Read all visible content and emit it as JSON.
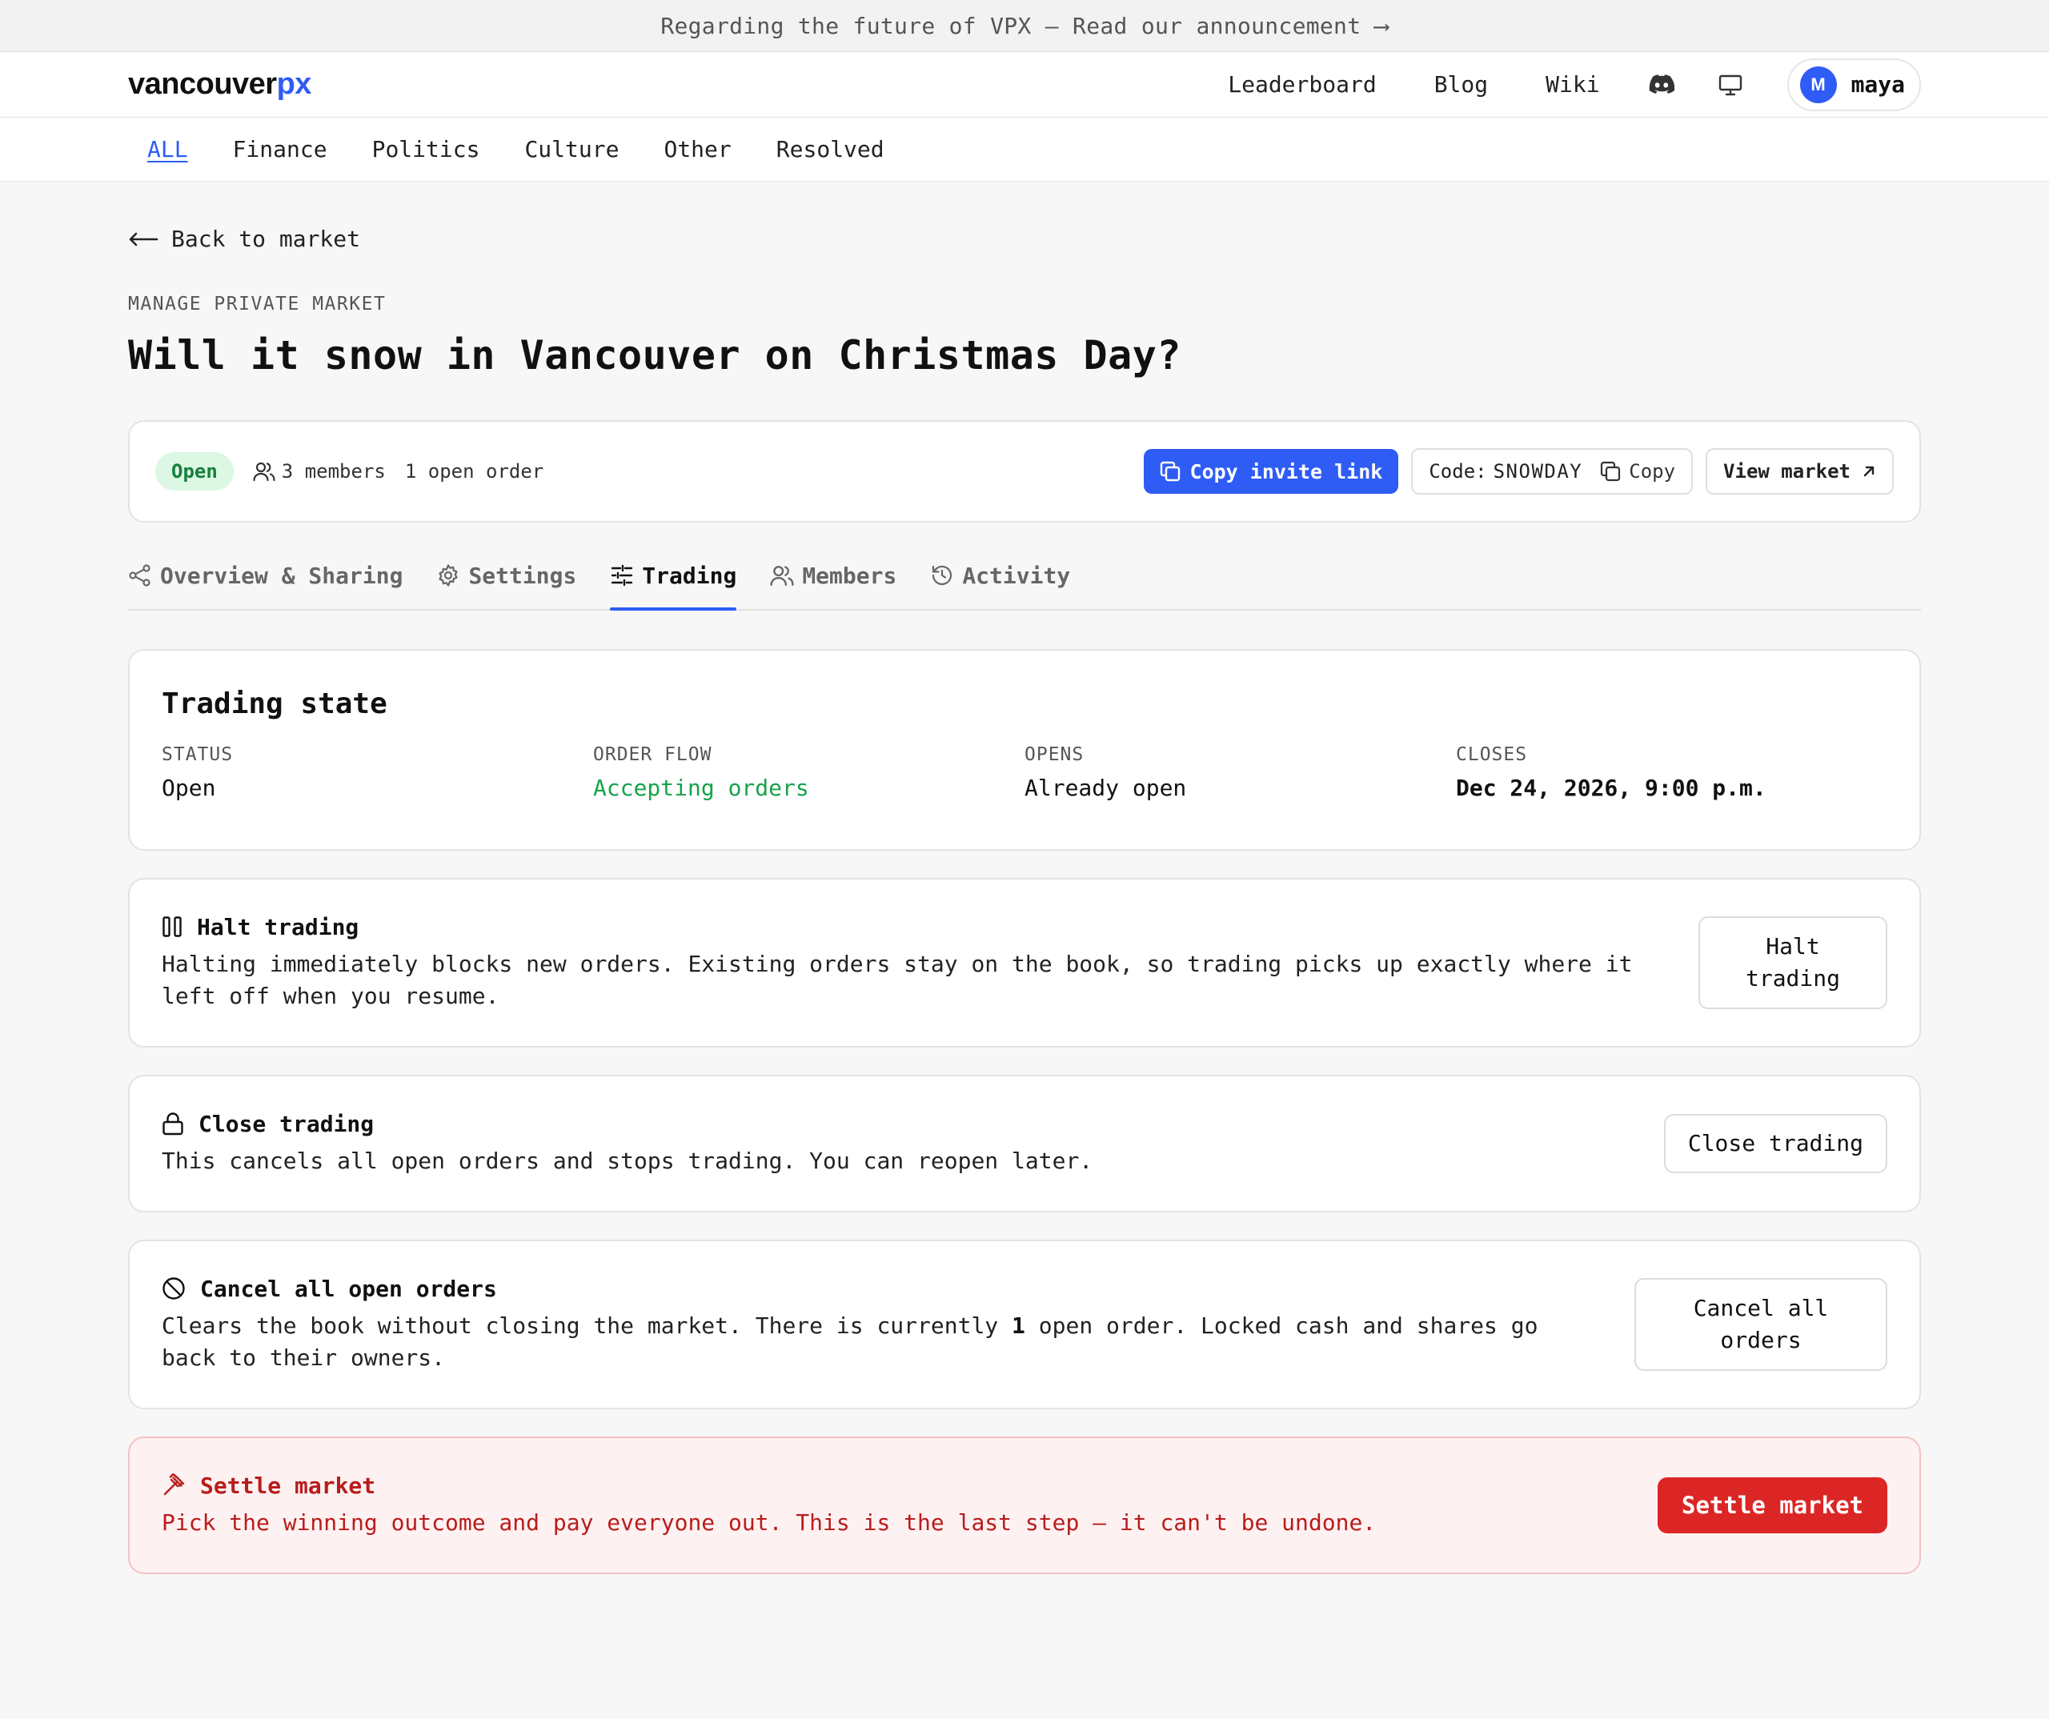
{
  "announcement": {
    "text": "Regarding the future of VPX — Read our announcement ⟶"
  },
  "header": {
    "logo_main": "vancouver",
    "logo_accent": "px",
    "links": [
      "Leaderboard",
      "Blog",
      "Wiki"
    ],
    "user": {
      "initial": "M",
      "name": "maya"
    }
  },
  "categories": [
    "ALL",
    "Finance",
    "Politics",
    "Culture",
    "Other",
    "Resolved"
  ],
  "back_label": "Back to market",
  "eyebrow": "MANAGE PRIVATE MARKET",
  "title": "Will it snow in Vancouver on Christmas Day?",
  "status_bar": {
    "badge": "Open",
    "members": "3 members",
    "orders": "1 open order",
    "copy_invite": "Copy invite link",
    "code_label": "Code:",
    "code_value": "SNOWDAY",
    "copy": "Copy",
    "view_market": "View market"
  },
  "tabs": [
    "Overview & Sharing",
    "Settings",
    "Trading",
    "Members",
    "Activity"
  ],
  "active_tab": "Trading",
  "trading_state": {
    "title": "Trading state",
    "fields": [
      {
        "label": "STATUS",
        "value": "Open"
      },
      {
        "label": "ORDER FLOW",
        "value": "Accepting orders"
      },
      {
        "label": "OPENS",
        "value": "Already open"
      },
      {
        "label": "CLOSES",
        "value": "Dec 24, 2026, 9:00 p.m."
      }
    ]
  },
  "halt": {
    "title": "Halt trading",
    "desc": "Halting immediately blocks new orders. Existing orders stay on the book, so trading picks up exactly where it left off when you resume.",
    "button": "Halt trading"
  },
  "close": {
    "title": "Close trading",
    "desc": "This cancels all open orders and stops trading. You can reopen later.",
    "button": "Close trading"
  },
  "cancel": {
    "title": "Cancel all open orders",
    "desc_before": "Clears the book without closing the market. There is currently ",
    "count": "1",
    "desc_after": " open order. Locked cash and shares go back to their owners.",
    "button": "Cancel all orders"
  },
  "settle": {
    "title": "Settle market",
    "desc": "Pick the winning outcome and pay everyone out. This is the last step — it can't be undone.",
    "button": "Settle market"
  },
  "colors": {
    "accent": "#2f5cf5",
    "success": "#16a34a",
    "danger": "#dc2626"
  }
}
